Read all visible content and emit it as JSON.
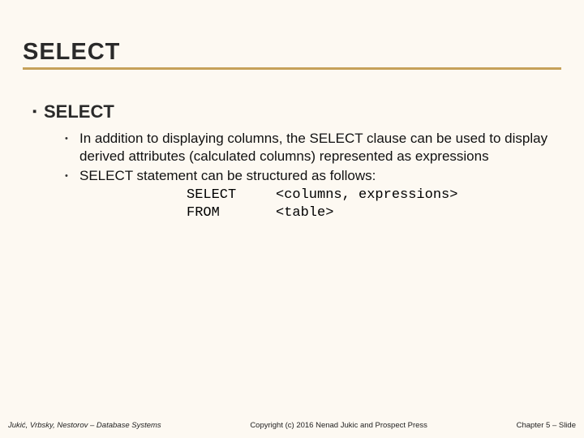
{
  "title": "SELECT",
  "content": {
    "heading": "SELECT",
    "bullets": [
      "In addition to displaying columns, the SELECT clause can be used to display derived attributes (calculated columns) represented as expressions",
      "SELECT statement can be structured as follows:"
    ],
    "code": {
      "line1_kw": "SELECT",
      "line1_arg": "<columns, expressions>",
      "line2_kw": "FROM",
      "line2_arg": "<table>"
    }
  },
  "footer": {
    "left": "Jukić, Vrbsky, Nestorov – Database Systems",
    "center": "Copyright (c) 2016 Nenad Jukic and Prospect Press",
    "right": "Chapter 5 – Slide"
  }
}
